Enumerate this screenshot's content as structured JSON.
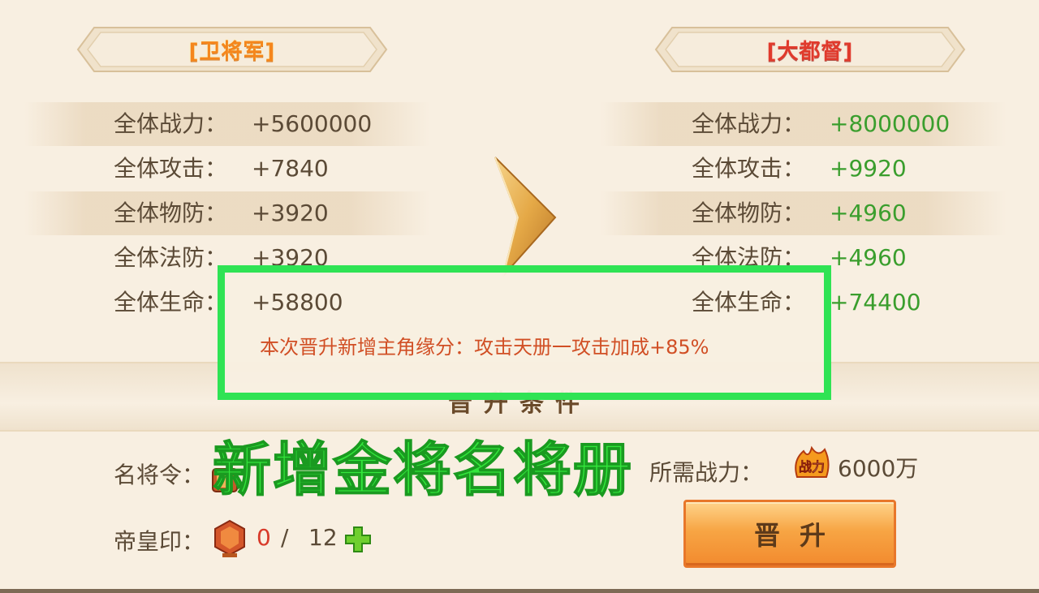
{
  "current_rank": {
    "title": "[卫将军]"
  },
  "next_rank": {
    "title": "[大都督]"
  },
  "stats": [
    {
      "label": "全体战力：",
      "current": "+5600000",
      "next": "+8000000"
    },
    {
      "label": "全体攻击：",
      "current": "+7840",
      "next": "+9920"
    },
    {
      "label": "全体物防：",
      "current": "+3920",
      "next": "+4960"
    },
    {
      "label": "全体法防：",
      "current": "+3920",
      "next": "+4960"
    },
    {
      "label": "全体生命：",
      "current": "+58800",
      "next": "+74400"
    }
  ],
  "bonus_text": "本次晋升新增主角缘分：攻击天册一攻击加成+85%",
  "conditions_title": "晋升条件",
  "overlay_caption": "新增金将名将册",
  "requirements": {
    "token_label": "名将令：",
    "seal_label": "帝皇印：",
    "seal_have": "0",
    "seal_sep": "/",
    "seal_need": "12",
    "power_label": "所需战力：",
    "power_icon_text": "战力",
    "power_value": "6000万"
  },
  "promote_button": "晋升",
  "colors": {
    "increase": "#3a9e2d",
    "highlight": "#2fe354",
    "shortfall": "#d83a2a",
    "button": "#f7a544"
  },
  "icons": [
    "arrow-right-icon",
    "token-icon",
    "seal-icon",
    "plus-icon",
    "power-icon"
  ]
}
